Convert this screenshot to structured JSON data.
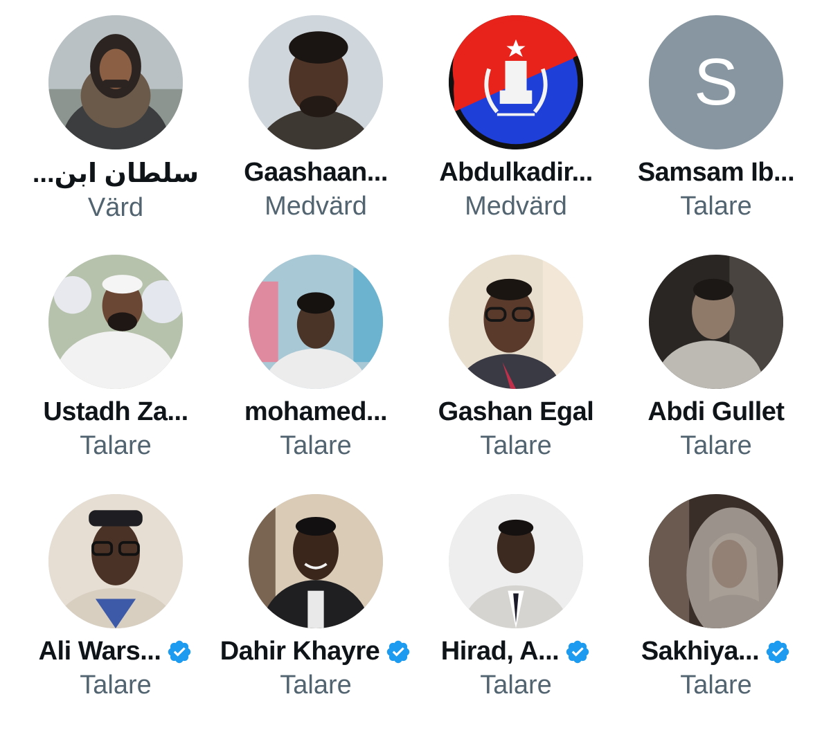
{
  "participants": [
    {
      "name": "سلطان ابن...",
      "role": "Värd",
      "verified": false,
      "avatar": "photo-man-long-hair-hoodie"
    },
    {
      "name": "Gaashaan...",
      "role": "Medvärd",
      "verified": false,
      "avatar": "photo-man-portrait"
    },
    {
      "name": "Abdulkadir...",
      "role": "Medvärd",
      "verified": false,
      "avatar": "emblem-red-blue-flag"
    },
    {
      "name": "Samsam Ib...",
      "role": "Talare",
      "verified": false,
      "avatar": "letter-avatar",
      "avatar_letter": "S"
    },
    {
      "name": "Ustadh Za...",
      "role": "Talare",
      "verified": false,
      "avatar": "photo-man-white-outfit"
    },
    {
      "name": "mohamed...",
      "role": "Talare",
      "verified": false,
      "avatar": "photo-man-indoor"
    },
    {
      "name": "Gashan Egal",
      "role": "Talare",
      "verified": false,
      "avatar": "photo-man-glasses"
    },
    {
      "name": "Abdi Gullet",
      "role": "Talare",
      "verified": false,
      "avatar": "photo-man-dark-room"
    },
    {
      "name": "Ali Wars...",
      "role": "Talare",
      "verified": true,
      "avatar": "photo-man-glasses-cap"
    },
    {
      "name": "Dahir Khayre",
      "role": "Talare",
      "verified": true,
      "avatar": "photo-man-smiling"
    },
    {
      "name": "Hirad, A...",
      "role": "Talare",
      "verified": true,
      "avatar": "photo-man-suit"
    },
    {
      "name": "Sakhiya...",
      "role": "Talare",
      "verified": true,
      "avatar": "photo-woman-hijab"
    }
  ],
  "colors": {
    "name": "#0f1419",
    "role": "#536471",
    "verified_badge": "#1d9bf0",
    "letter_avatar_bg": "#8796a0"
  }
}
